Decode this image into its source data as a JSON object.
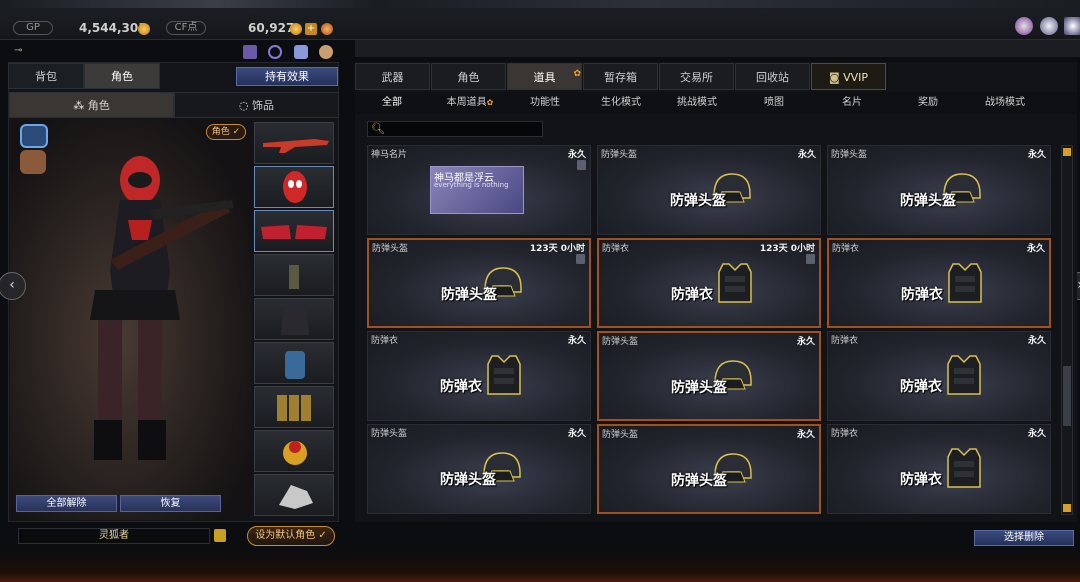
{
  "topbar": {
    "gp_label": "GP",
    "gp_value": "4,544,301",
    "cf_label": "CF点",
    "cf_value": "60,927",
    "plus": "+"
  },
  "left": {
    "tabs": [
      "背包",
      "角色"
    ],
    "active_tab": 1,
    "hold_effect": "持有效果",
    "subtabs": [
      "角色",
      "饰品"
    ],
    "role_badge": "角色 ✓",
    "btn_clear": "全部解除",
    "btn_restore": "恢复",
    "name": "灵狐者",
    "btn_default": "设为默认角色 ✓"
  },
  "right": {
    "tabs": [
      "武器",
      "角色",
      "道具",
      "暂存箱",
      "交易所",
      "回收站",
      "VVIP"
    ],
    "active_tab": 2,
    "filters": [
      "全部",
      "本周道具",
      "功能性",
      "生化模式",
      "挑战模式",
      "喷图",
      "名片",
      "奖励",
      "战场模式"
    ],
    "active_filter": 0,
    "delete_btn": "选择删除"
  },
  "items": [
    {
      "name": "神马名片",
      "duration": "永久",
      "type": "card",
      "trash": true,
      "title": "神马都是浮云",
      "subtitle": "everything is nothing",
      "highlight": false
    },
    {
      "name": "防弹头盔",
      "duration": "永久",
      "type": "helmet",
      "big": "防弹头盔",
      "highlight": false
    },
    {
      "name": "防弹头盔",
      "duration": "永久",
      "type": "helmet",
      "big": "防弹头盔",
      "highlight": false
    },
    {
      "name": "防弹头盔",
      "duration": "123天 0小时",
      "type": "helmet",
      "big": "防弹头盔",
      "trash": true,
      "highlight": true
    },
    {
      "name": "防弹衣",
      "duration": "123天 0小时",
      "type": "vest",
      "big": "防弹衣",
      "trash": true,
      "highlight": true
    },
    {
      "name": "防弹衣",
      "duration": "永久",
      "type": "vest",
      "big": "防弹衣",
      "highlight": true
    },
    {
      "name": "防弹衣",
      "duration": "永久",
      "type": "vest",
      "big": "防弹衣",
      "highlight": false
    },
    {
      "name": "防弹头盔",
      "duration": "永久",
      "type": "helmet",
      "big": "防弹头盔",
      "highlight": true
    },
    {
      "name": "防弹衣",
      "duration": "永久",
      "type": "vest",
      "big": "防弹衣",
      "highlight": false
    },
    {
      "name": "防弹头盔",
      "duration": "永久",
      "type": "helmet",
      "big": "防弹头盔",
      "highlight": false
    },
    {
      "name": "防弹头盔",
      "duration": "永久",
      "type": "helmet",
      "big": "防弹头盔",
      "highlight": true
    },
    {
      "name": "防弹衣",
      "duration": "永久",
      "type": "vest",
      "big": "防弹衣",
      "highlight": false
    }
  ]
}
